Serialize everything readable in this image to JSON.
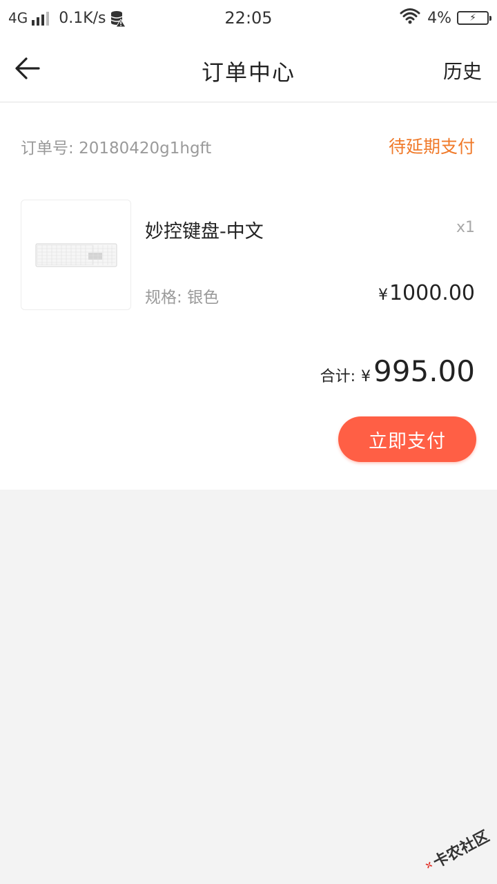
{
  "status_bar": {
    "network": "4G",
    "speed": "0.1K/s",
    "time": "22:05",
    "battery": "4%",
    "icons": [
      "signal-icon",
      "database-warning-icon",
      "wifi-icon",
      "battery-charging-icon"
    ]
  },
  "nav": {
    "title": "订单中心",
    "history": "历史",
    "back_icon": "arrow-left-icon"
  },
  "order": {
    "number_label": "订单号:",
    "number": "20180420g1hgft",
    "status": "待延期支付",
    "product": {
      "name": "妙控键盘-中文",
      "quantity": "x1",
      "spec_label": "规格:",
      "spec_value": "银色",
      "price_symbol": "¥",
      "price": "1000.00",
      "image_icon": "keyboard-image"
    },
    "total_label": "合计:",
    "total_symbol": "¥",
    "total": "995.00",
    "pay_button": "立即支付"
  },
  "watermark": {
    "text": "卡农社区"
  },
  "colors": {
    "accent": "#ff5f45",
    "status": "#f07a2a",
    "background": "#f3f3f3"
  }
}
